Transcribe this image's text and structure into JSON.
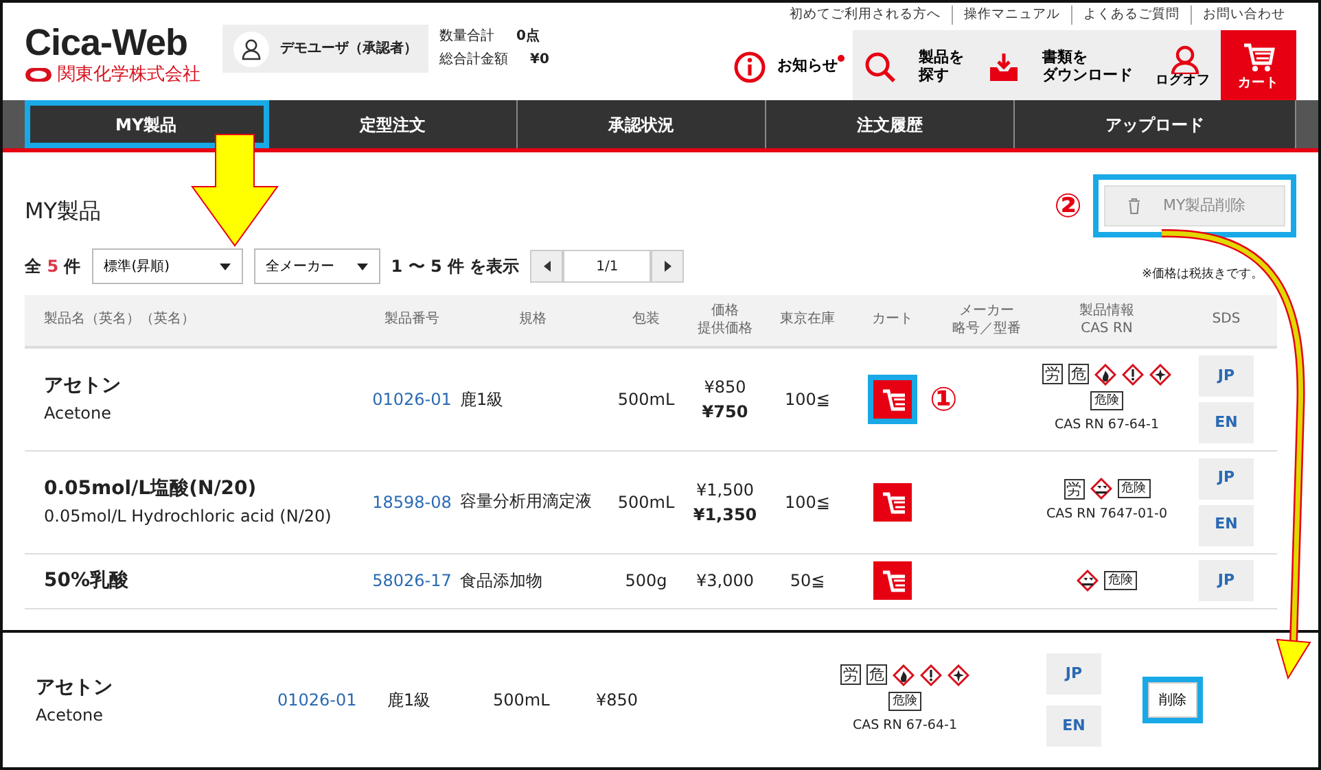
{
  "header": {
    "logo": {
      "title": "Cica-Web",
      "company": "関東化学株式会社"
    },
    "user": "デモユーザ（承認者）",
    "totals": [
      {
        "label": "数量合計",
        "value": "0点"
      },
      {
        "label": "総合計金額",
        "value": "¥0"
      }
    ],
    "top_links": [
      "初めてご利用される方へ",
      "操作マニュアル",
      "よくあるご質問",
      "お問い合わせ"
    ],
    "actions": [
      {
        "kind": "info",
        "label": "お知らせ",
        "unread": true
      },
      {
        "kind": "search",
        "label": [
          "製品を",
          "探す"
        ]
      },
      {
        "kind": "download",
        "label": [
          "書類を",
          "ダウンロード"
        ]
      },
      {
        "kind": "user",
        "label": "ログオフ"
      },
      {
        "kind": "cart",
        "label": "カート"
      }
    ]
  },
  "nav": [
    {
      "label": "MY製品",
      "highlighted": true
    },
    {
      "label": "定型注文",
      "highlighted": false
    },
    {
      "label": "承認状況",
      "highlighted": false
    },
    {
      "label": "注文履歴",
      "highlighted": false
    },
    {
      "label": "アップロード",
      "highlighted": false
    }
  ],
  "page_title": "MY製品",
  "delete_button": {
    "label": "MY製品削除",
    "highlighted": true,
    "callout": "②"
  },
  "toolbar": {
    "count_prefix": "全",
    "count": "5",
    "count_suffix": "件",
    "sort": "標準(昇順)",
    "maker": "全メーカー",
    "range": "1 〜 5 件 を表示",
    "page": "1/1",
    "note": "※価格は税抜きです。"
  },
  "columns": [
    [
      "製品名（英名）（英名）"
    ],
    [
      "製品番号"
    ],
    [
      "規格"
    ],
    [
      "包装"
    ],
    [
      "価格",
      "提供価格"
    ],
    [
      "東京在庫"
    ],
    [
      "カート"
    ],
    [
      "メーカー",
      "略号／型番"
    ],
    [
      "製品情報",
      "CAS RN"
    ],
    [
      "SDS"
    ]
  ],
  "rows": [
    {
      "name_ja": "アセトン",
      "name_en": "Acetone",
      "number": "01026-01",
      "spec": "鹿1級",
      "package": "500mL",
      "price": "¥850",
      "offer_price": "¥750",
      "stock": "100≦",
      "cart": {
        "highlighted": true,
        "callout": "①"
      },
      "hazard": {
        "marks": [
          "労",
          "危"
        ],
        "pictograms": [
          {
            "kind": "flame"
          },
          {
            "kind": "exclamation"
          },
          {
            "kind": "health"
          }
        ],
        "signal": "危険",
        "cas": "CAS RN 67-64-1"
      },
      "sds": [
        "JP",
        "EN"
      ]
    },
    {
      "name_ja": "0.05mol/L塩酸(N/20)",
      "name_en": "0.05mol/L Hydrochloric acid (N/20)",
      "number": "18598-08",
      "spec": "容量分析用滴定液",
      "package": "500mL",
      "price": "¥1,500",
      "offer_price": "¥1,350",
      "stock": "100≦",
      "cart": {
        "highlighted": false
      },
      "hazard": {
        "marks": [
          "労"
        ],
        "pictograms": [
          {
            "kind": "corrosion"
          }
        ],
        "signal": "危険",
        "cas": "CAS RN 7647-01-0"
      },
      "sds": [
        "JP",
        "EN"
      ]
    },
    {
      "name_ja": "50%乳酸",
      "number": "58026-17",
      "spec": "食品添加物",
      "package": "500g",
      "price": "¥3,000",
      "stock": "50≦",
      "cart": {
        "highlighted": false
      },
      "hazard": {
        "pictograms": [
          {
            "kind": "corrosion"
          }
        ],
        "signal": "危険"
      },
      "sds": [
        "JP"
      ]
    }
  ],
  "panel": {
    "name_ja": "アセトン",
    "name_en": "Acetone",
    "number": "01026-01",
    "spec": "鹿1級",
    "package": "500mL",
    "price": "¥850",
    "hazard": {
      "marks": [
        "労",
        "危"
      ],
      "pictograms": [
        {
          "kind": "flame"
        },
        {
          "kind": "exclamation"
        },
        {
          "kind": "health"
        }
      ],
      "signal": "危険",
      "cas": "CAS RN 67-64-1"
    },
    "sds": [
      "JP",
      "EN"
    ],
    "delete": {
      "label": "削除",
      "highlighted": true
    }
  }
}
